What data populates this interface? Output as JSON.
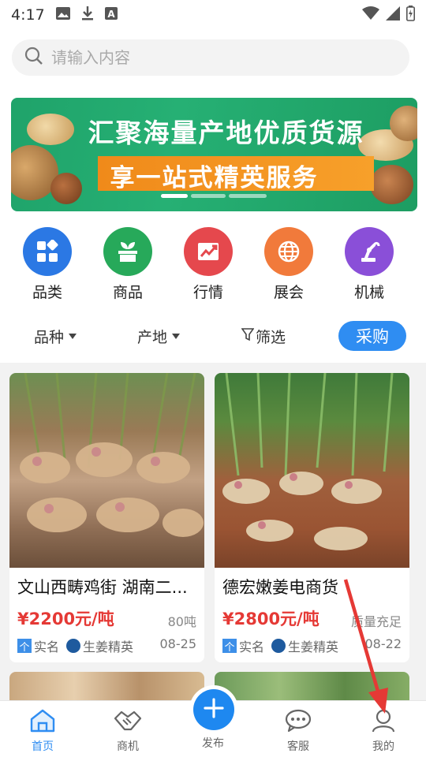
{
  "status_bar": {
    "time": "4:17"
  },
  "search": {
    "placeholder": "请输入内容"
  },
  "banner": {
    "line1": "汇聚海量产地优质货源",
    "line2": "享一站式精英服务",
    "slides": 3,
    "active_slide": 1
  },
  "categories": [
    {
      "label": "品类",
      "icon": "grid-icon",
      "color": "#2b78e4"
    },
    {
      "label": "商品",
      "icon": "plant-box-icon",
      "color": "#27a95a"
    },
    {
      "label": "行情",
      "icon": "trend-chart-icon",
      "color": "#e5484d"
    },
    {
      "label": "展会",
      "icon": "globe-icon",
      "color": "#f17a3b"
    },
    {
      "label": "机械",
      "icon": "robot-arm-icon",
      "color": "#8a4fd8"
    }
  ],
  "filters": {
    "variety": "品种",
    "origin": "产地",
    "screen": "筛选",
    "buy": "采购"
  },
  "products": [
    {
      "title": "文山西畴鸡街 湖南二...",
      "price": "¥2200元/吨",
      "stock": "80吨",
      "tag_real": "实名",
      "tag_real_icon": "个",
      "tag_member": "生姜精英",
      "date": "08-25"
    },
    {
      "title": "德宏嫩姜电商货",
      "price": "¥2800元/吨",
      "stock": "质量充足",
      "tag_real": "实名",
      "tag_real_icon": "个",
      "tag_member": "生姜精英",
      "date": "08-22"
    }
  ],
  "tabbar": [
    {
      "label": "首页",
      "icon": "home-icon",
      "active": true
    },
    {
      "label": "商机",
      "icon": "handshake-icon",
      "active": false
    },
    {
      "label": "发布",
      "icon": "plus-icon",
      "active": false
    },
    {
      "label": "客服",
      "icon": "chat-icon",
      "active": false
    },
    {
      "label": "我的",
      "icon": "user-icon",
      "active": false
    }
  ],
  "colors": {
    "accent": "#2f8df2",
    "price": "#e53935",
    "banner_green": "#26b074",
    "banner_orange": "#f7a02a"
  }
}
